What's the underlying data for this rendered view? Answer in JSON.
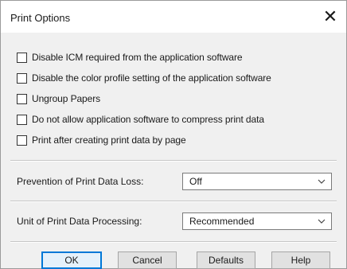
{
  "window": {
    "title": "Print Options",
    "close_glyph": "✕"
  },
  "checkboxes": [
    {
      "label": "Disable ICM required from the application software",
      "checked": false
    },
    {
      "label": "Disable the color profile setting of the application software",
      "checked": false
    },
    {
      "label": "Ungroup Papers",
      "checked": false
    },
    {
      "label": "Do not allow application software to compress print data",
      "checked": false
    },
    {
      "label": "Print after creating print data by page",
      "checked": false
    }
  ],
  "fields": {
    "prevention": {
      "label": "Prevention of Print Data Loss:",
      "value": "Off"
    },
    "unit": {
      "label": "Unit of Print Data Processing:",
      "value": "Recommended"
    }
  },
  "buttons": {
    "ok": "OK",
    "cancel": "Cancel",
    "defaults": "Defaults",
    "help": "Help"
  },
  "colors": {
    "accent": "#0078d7",
    "dialog_bg": "#f0f0f0"
  }
}
